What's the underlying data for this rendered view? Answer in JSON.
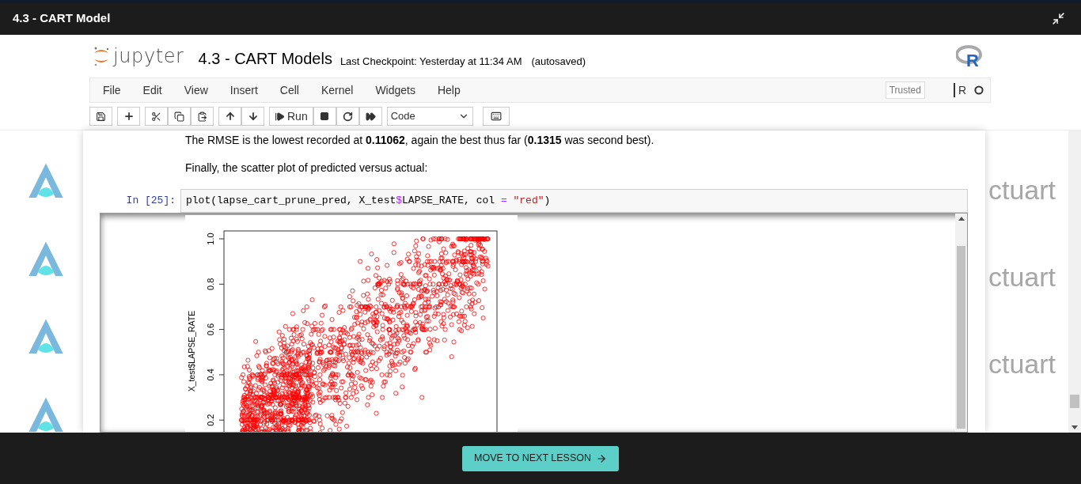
{
  "window": {
    "title": "4.3 - CART Model"
  },
  "notebook": {
    "logo_text": "jupyter",
    "title": "4.3 - CART Models",
    "checkpoint": "Last Checkpoint: Yesterday at 11:34 AM",
    "autosave": "(autosaved)",
    "kernel_logo_letter": "R"
  },
  "menu": [
    "File",
    "Edit",
    "View",
    "Insert",
    "Cell",
    "Kernel",
    "Widgets",
    "Help"
  ],
  "status": {
    "trusted": "Trusted",
    "kernel_name": "R"
  },
  "toolbar": {
    "run_label": "Run",
    "cell_type": "Code"
  },
  "cells": [
    {
      "kind": "markdown",
      "text": "The RMSE is the lowest recorded at **0.11062**, again the best thus far (**0.1315** was second best)."
    },
    {
      "kind": "markdown",
      "text": "Finally, the scatter plot of predicted versus actual:"
    },
    {
      "kind": "code",
      "prompt": "In [25]:",
      "tokens": [
        {
          "kind": "plain",
          "text": "plot(lapse_cart_prune_pred, X_test"
        },
        {
          "kind": "operator",
          "text": "$"
        },
        {
          "kind": "plain",
          "text": "LAPSE_RATE, col "
        },
        {
          "kind": "operator",
          "text": "="
        },
        {
          "kind": "string",
          "text": " \"red\""
        },
        {
          "kind": "plain",
          "text": ")"
        }
      ]
    }
  ],
  "output": {
    "plot": {
      "ylabel": "X_test$LAPSE_RATE",
      "y_tick_labels": [
        "1.0",
        "0.8",
        "0.6",
        "0.4",
        "0.2"
      ]
    }
  },
  "background": {
    "side_texts": [
      "ctuart",
      "ctuart",
      "ctuart"
    ]
  },
  "footer": {
    "button": "MOVE TO NEXT LESSON"
  }
}
